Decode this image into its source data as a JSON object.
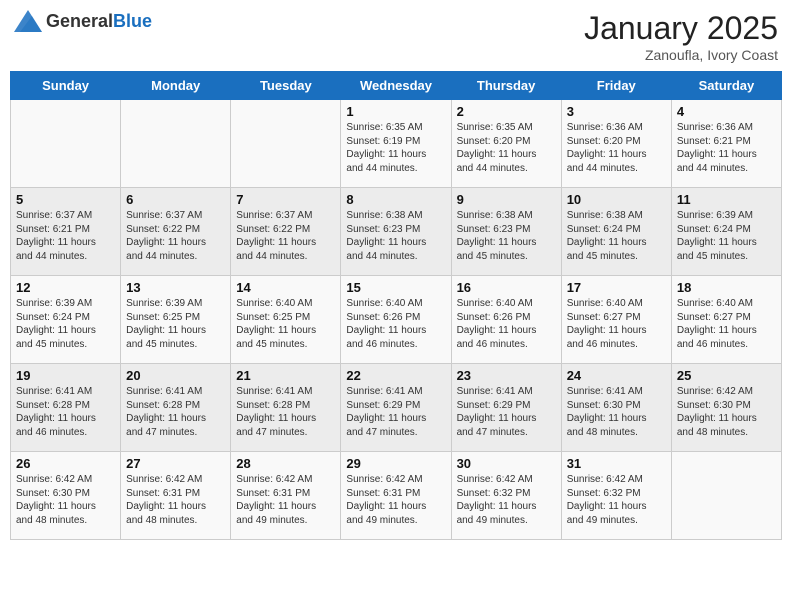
{
  "header": {
    "logo_general": "General",
    "logo_blue": "Blue",
    "month_title": "January 2025",
    "subtitle": "Zanoufla, Ivory Coast"
  },
  "days_of_week": [
    "Sunday",
    "Monday",
    "Tuesday",
    "Wednesday",
    "Thursday",
    "Friday",
    "Saturday"
  ],
  "weeks": [
    [
      {
        "day": "",
        "info": ""
      },
      {
        "day": "",
        "info": ""
      },
      {
        "day": "",
        "info": ""
      },
      {
        "day": "1",
        "info": "Sunrise: 6:35 AM\nSunset: 6:19 PM\nDaylight: 11 hours and 44 minutes."
      },
      {
        "day": "2",
        "info": "Sunrise: 6:35 AM\nSunset: 6:20 PM\nDaylight: 11 hours and 44 minutes."
      },
      {
        "day": "3",
        "info": "Sunrise: 6:36 AM\nSunset: 6:20 PM\nDaylight: 11 hours and 44 minutes."
      },
      {
        "day": "4",
        "info": "Sunrise: 6:36 AM\nSunset: 6:21 PM\nDaylight: 11 hours and 44 minutes."
      }
    ],
    [
      {
        "day": "5",
        "info": "Sunrise: 6:37 AM\nSunset: 6:21 PM\nDaylight: 11 hours and 44 minutes."
      },
      {
        "day": "6",
        "info": "Sunrise: 6:37 AM\nSunset: 6:22 PM\nDaylight: 11 hours and 44 minutes."
      },
      {
        "day": "7",
        "info": "Sunrise: 6:37 AM\nSunset: 6:22 PM\nDaylight: 11 hours and 44 minutes."
      },
      {
        "day": "8",
        "info": "Sunrise: 6:38 AM\nSunset: 6:23 PM\nDaylight: 11 hours and 44 minutes."
      },
      {
        "day": "9",
        "info": "Sunrise: 6:38 AM\nSunset: 6:23 PM\nDaylight: 11 hours and 45 minutes."
      },
      {
        "day": "10",
        "info": "Sunrise: 6:38 AM\nSunset: 6:24 PM\nDaylight: 11 hours and 45 minutes."
      },
      {
        "day": "11",
        "info": "Sunrise: 6:39 AM\nSunset: 6:24 PM\nDaylight: 11 hours and 45 minutes."
      }
    ],
    [
      {
        "day": "12",
        "info": "Sunrise: 6:39 AM\nSunset: 6:24 PM\nDaylight: 11 hours and 45 minutes."
      },
      {
        "day": "13",
        "info": "Sunrise: 6:39 AM\nSunset: 6:25 PM\nDaylight: 11 hours and 45 minutes."
      },
      {
        "day": "14",
        "info": "Sunrise: 6:40 AM\nSunset: 6:25 PM\nDaylight: 11 hours and 45 minutes."
      },
      {
        "day": "15",
        "info": "Sunrise: 6:40 AM\nSunset: 6:26 PM\nDaylight: 11 hours and 46 minutes."
      },
      {
        "day": "16",
        "info": "Sunrise: 6:40 AM\nSunset: 6:26 PM\nDaylight: 11 hours and 46 minutes."
      },
      {
        "day": "17",
        "info": "Sunrise: 6:40 AM\nSunset: 6:27 PM\nDaylight: 11 hours and 46 minutes."
      },
      {
        "day": "18",
        "info": "Sunrise: 6:40 AM\nSunset: 6:27 PM\nDaylight: 11 hours and 46 minutes."
      }
    ],
    [
      {
        "day": "19",
        "info": "Sunrise: 6:41 AM\nSunset: 6:28 PM\nDaylight: 11 hours and 46 minutes."
      },
      {
        "day": "20",
        "info": "Sunrise: 6:41 AM\nSunset: 6:28 PM\nDaylight: 11 hours and 47 minutes."
      },
      {
        "day": "21",
        "info": "Sunrise: 6:41 AM\nSunset: 6:28 PM\nDaylight: 11 hours and 47 minutes."
      },
      {
        "day": "22",
        "info": "Sunrise: 6:41 AM\nSunset: 6:29 PM\nDaylight: 11 hours and 47 minutes."
      },
      {
        "day": "23",
        "info": "Sunrise: 6:41 AM\nSunset: 6:29 PM\nDaylight: 11 hours and 47 minutes."
      },
      {
        "day": "24",
        "info": "Sunrise: 6:41 AM\nSunset: 6:30 PM\nDaylight: 11 hours and 48 minutes."
      },
      {
        "day": "25",
        "info": "Sunrise: 6:42 AM\nSunset: 6:30 PM\nDaylight: 11 hours and 48 minutes."
      }
    ],
    [
      {
        "day": "26",
        "info": "Sunrise: 6:42 AM\nSunset: 6:30 PM\nDaylight: 11 hours and 48 minutes."
      },
      {
        "day": "27",
        "info": "Sunrise: 6:42 AM\nSunset: 6:31 PM\nDaylight: 11 hours and 48 minutes."
      },
      {
        "day": "28",
        "info": "Sunrise: 6:42 AM\nSunset: 6:31 PM\nDaylight: 11 hours and 49 minutes."
      },
      {
        "day": "29",
        "info": "Sunrise: 6:42 AM\nSunset: 6:31 PM\nDaylight: 11 hours and 49 minutes."
      },
      {
        "day": "30",
        "info": "Sunrise: 6:42 AM\nSunset: 6:32 PM\nDaylight: 11 hours and 49 minutes."
      },
      {
        "day": "31",
        "info": "Sunrise: 6:42 AM\nSunset: 6:32 PM\nDaylight: 11 hours and 49 minutes."
      },
      {
        "day": "",
        "info": ""
      }
    ]
  ]
}
